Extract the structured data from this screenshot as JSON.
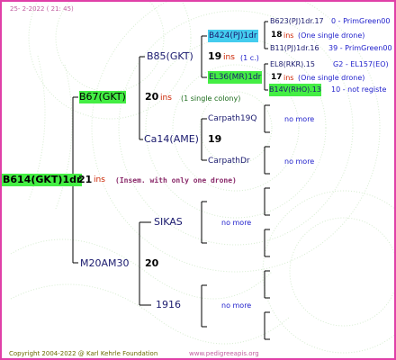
{
  "header": {
    "date": "25-  2-2022 ( 21: 45)"
  },
  "footer": {
    "copyright": "Copyright 2004-2022 @ Karl Kehrle Foundation",
    "url": "www.pedigreeapis.org"
  },
  "colors": {
    "frame": "#e040a8",
    "highlight_green": "#44ee44",
    "highlight_cyan": "#44ccee",
    "inbreeding_red": "#cc2200",
    "label_blue": "#2222cc",
    "label_navy": "#1a1a6e"
  },
  "root": {
    "id": "B614(GKT)1dr",
    "year": "21",
    "ins": "ins",
    "note": "(Insem. with only one drone)"
  },
  "queen": {
    "id": "B67(GKT)",
    "year": "20",
    "ins": "ins",
    "note": "(1 single colony)"
  },
  "qq": {
    "id": "B85(GKT)",
    "year": "19",
    "ins": "ins",
    "note": "(1 c.)"
  },
  "qq_parents": {
    "mother": {
      "id": "B424(PJ)1dr"
    },
    "father": {
      "id": "EL36(MR)1dr"
    }
  },
  "gen5": {
    "b623": "B623(PJ)1dr.17",
    "b623_extra": "0 - PrimGreen00",
    "b424_year": "18",
    "b424_ins": "ins",
    "b424_note": "(One single drone)",
    "b11": "B11(PJ)1dr.16",
    "b11_extra": "39 - PrimGreen00",
    "el8": "EL8(RKR).15",
    "el8_extra": "G2 - EL157(EO)",
    "el36_year": "17",
    "el36_ins": "ins",
    "el36_note": "(One single drone)",
    "b14v": "B14V(RHO).13",
    "b14v_extra": "10 - not registe"
  },
  "ca14": {
    "id": "Ca14(AME)",
    "year": "19"
  },
  "carpath19q": {
    "id": "Carpath19Q",
    "more": "no more"
  },
  "carpathdr": {
    "id": "CarpathDr",
    "more": "no more"
  },
  "m20": {
    "id": "M20AM30",
    "year": "20"
  },
  "sikas": {
    "id": "SIKAS",
    "more": "no more"
  },
  "n1916": {
    "id": "1916",
    "more": "no more"
  }
}
